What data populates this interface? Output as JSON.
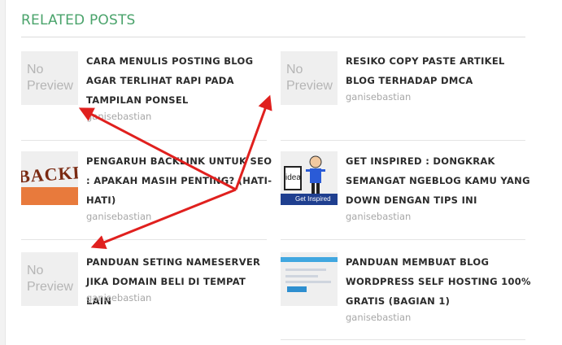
{
  "section": {
    "heading": "RELATED POSTS"
  },
  "thumb": {
    "no_preview_line1": "No",
    "no_preview_line2": "Preview",
    "backlink_text": "BACKLINK",
    "idea_text": "idea",
    "idea_caption": "Get Inspired"
  },
  "posts": [
    {
      "title": "CARA MENULIS POSTING BLOG AGAR TERLIHAT RAPI PADA TAMPILAN PONSEL",
      "author": "ganisebastian",
      "thumbnail": "no-preview"
    },
    {
      "title": "RESIKO COPY PASTE ARTIKEL BLOG TERHADAP DMCA",
      "author": "ganisebastian",
      "thumbnail": "no-preview"
    },
    {
      "title": "PENGARUH BACKLINK UNTUK SEO : APAKAH MASIH PENTING? (HATI-HATI)",
      "author": "ganisebastian",
      "thumbnail": "backlink-image"
    },
    {
      "title": "GET INSPIRED : DONGKRAK SEMANGAT NGEBLOG KAMU YANG DOWN DENGAN TIPS INI",
      "author": "ganisebastian",
      "thumbnail": "idea-image"
    },
    {
      "title": "PANDUAN SETING NAMESERVER JIKA DOMAIN BELI DI TEMPAT LAIN",
      "author": "ganisebastian",
      "thumbnail": "no-preview"
    },
    {
      "title": "PANDUAN MEMBUAT BLOG WORDPRESS SELF HOSTING 100% GRATIS (BAGIAN 1)",
      "author": "ganisebastian",
      "thumbnail": "wordpress-screenshot"
    }
  ],
  "colors": {
    "heading": "#4aa36b",
    "arrow": "#e0201e",
    "title": "#2b2b2b",
    "author": "#a7a7a7"
  }
}
